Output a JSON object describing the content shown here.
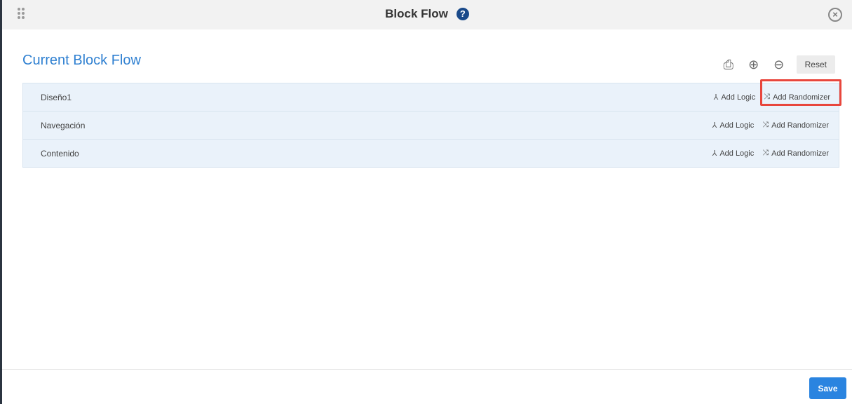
{
  "header": {
    "title": "Block Flow",
    "help_icon": "?",
    "close_icon": "×"
  },
  "main": {
    "heading": "Current Block Flow",
    "toolbar": {
      "pdf_icon": "⎙",
      "zoom_in_icon": "⊕",
      "zoom_out_icon": "⊖",
      "reset_label": "Reset"
    },
    "blocks": [
      {
        "name": "Diseño1",
        "logic_label": "Add Logic",
        "randomizer_label": "Add Randomizer",
        "highlighted": true
      },
      {
        "name": "Navegación",
        "logic_label": "Add Logic",
        "randomizer_label": "Add Randomizer"
      },
      {
        "name": "Contenido",
        "logic_label": "Add Logic",
        "randomizer_label": "Add Randomizer"
      }
    ],
    "icons": {
      "logic": "⅄",
      "randomizer": "⤨"
    },
    "highlight_color": "#e8463c"
  },
  "footer": {
    "save_label": "Save"
  }
}
